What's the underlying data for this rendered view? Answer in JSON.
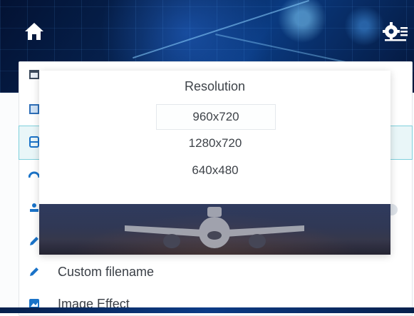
{
  "header": {
    "home_icon": "home-icon",
    "settings_icon": "settings-menu-icon"
  },
  "menu": {
    "items": [
      {
        "icon": "calendar-icon",
        "label": ""
      },
      {
        "icon": "photo-frame-icon",
        "label": ""
      },
      {
        "icon": "storage-icon",
        "label": "",
        "selected": true
      },
      {
        "icon": "speed-icon",
        "label": ""
      },
      {
        "icon": "person-icon",
        "label": ""
      },
      {
        "icon": "pencil-icon",
        "label": ""
      },
      {
        "icon": "pencil-icon",
        "label": "Custom filename"
      },
      {
        "icon": "image-icon",
        "label": "Image Effect"
      }
    ]
  },
  "popup": {
    "title": "Resolution",
    "options": [
      "960x720",
      "1280x720",
      "640x480"
    ],
    "selected_option": "960x720"
  },
  "colors": {
    "accent": "#1a73c8",
    "highlight_border": "#7fd0dc",
    "highlight_fill": "#e9f6f8"
  }
}
